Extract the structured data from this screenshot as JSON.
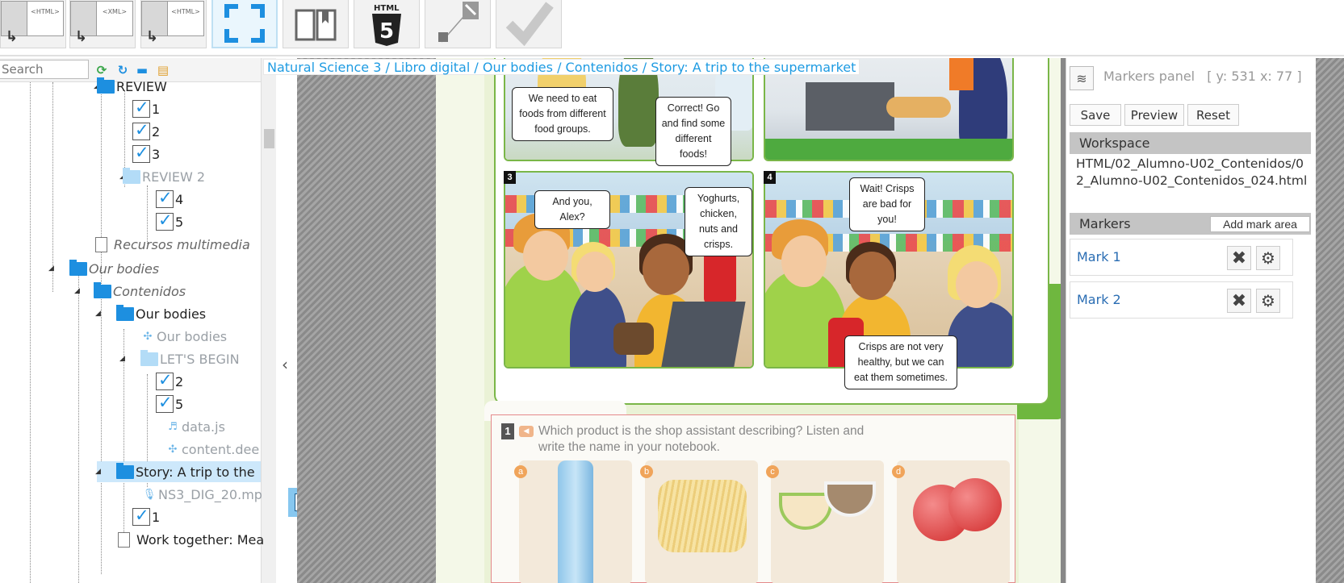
{
  "toolbar": {
    "buttons": [
      {
        "name": "html-to-html",
        "label": "<HTML>"
      },
      {
        "name": "xml-to-html",
        "label": "<XML>"
      },
      {
        "name": "html-convert",
        "label": "<HTML>"
      },
      {
        "name": "fullscreen"
      },
      {
        "name": "book-view"
      },
      {
        "name": "html5"
      },
      {
        "name": "edit"
      },
      {
        "name": "validate"
      }
    ]
  },
  "tree": {
    "search_placeholder": "Search",
    "items": [
      {
        "label": "REVIEW",
        "type": "folder"
      },
      {
        "label": "1",
        "type": "check"
      },
      {
        "label": "2",
        "type": "check"
      },
      {
        "label": "3",
        "type": "check"
      },
      {
        "label": "REVIEW 2",
        "type": "folder-light"
      },
      {
        "label": "4",
        "type": "check"
      },
      {
        "label": "5",
        "type": "check"
      },
      {
        "label": "Recursos multimedia",
        "type": "doc"
      },
      {
        "label": "Our bodies",
        "type": "folder"
      },
      {
        "label": "Contenidos",
        "type": "folder"
      },
      {
        "label": "Our bodies",
        "type": "folder"
      },
      {
        "label": "Our bodies",
        "type": "puzzle"
      },
      {
        "label": "LET'S BEGIN",
        "type": "folder-light"
      },
      {
        "label": "2",
        "type": "check"
      },
      {
        "label": "5",
        "type": "check"
      },
      {
        "label": "data.js",
        "type": "file"
      },
      {
        "label": "content.dee",
        "type": "puzzle"
      },
      {
        "label": "Story: A trip to the",
        "type": "folder"
      },
      {
        "label": "NS3_DIG_20.mp",
        "type": "audio"
      },
      {
        "label": "1",
        "type": "check"
      },
      {
        "label": "Work together: Mea",
        "type": "doc"
      }
    ]
  },
  "breadcrumb": "Natural Science 3 / Libro digital / Our bodies / Contenidos / Story: A trip to the supermarket",
  "story": {
    "panels": [
      {
        "number": "3"
      },
      {
        "number": "4"
      }
    ],
    "bubbles": {
      "b1": "We need to eat foods from different food groups.",
      "b2": "Correct! Go and find some different foods!",
      "b3": "And you, Alex?",
      "b4": "Yoghurts, chicken, nuts and crisps.",
      "b5": "Wait! Crisps are bad for you!",
      "b6": "Crisps are not very healthy, but we can eat them sometimes."
    }
  },
  "activity": {
    "number": "1",
    "text": "Which product is the shop assistant describing? Listen and write the name in your notebook.",
    "products": [
      {
        "letter": "a"
      },
      {
        "letter": "b"
      },
      {
        "letter": "c"
      },
      {
        "letter": "d"
      }
    ]
  },
  "markers_panel": {
    "title": "Markers panel",
    "coords": "[ y: 531 x: 77 ]",
    "save_label": "Save",
    "preview_label": "Preview",
    "reset_label": "Reset",
    "workspace_heading": "Workspace",
    "workspace_path": "HTML/02_Alumno-U02_Contenidos/02_Alumno-U02_Contenidos_024.html",
    "markers_heading": "Markers",
    "add_mark_label": "Add mark area",
    "marks": [
      {
        "label": "Mark 1"
      },
      {
        "label": "Mark 2"
      }
    ]
  }
}
